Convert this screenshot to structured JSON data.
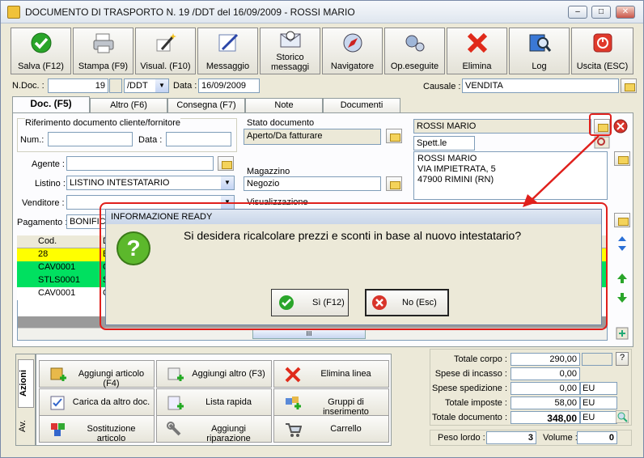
{
  "window": {
    "title": "DOCUMENTO DI TRASPORTO N. 19 /DDT del 16/09/2009 - ROSSI MARIO",
    "min": "–",
    "max": "□",
    "close": "✕"
  },
  "toolbar": [
    {
      "label": "Salva (F12)",
      "icon": "check-icon"
    },
    {
      "label": "Stampa (F9)",
      "icon": "printer-icon"
    },
    {
      "label": "Visual. (F10)",
      "icon": "magic-wand-icon"
    },
    {
      "label": "Messaggio",
      "icon": "message-icon"
    },
    {
      "label": "Storico messaggi",
      "icon": "message-history-icon"
    },
    {
      "label": "Navigatore",
      "icon": "compass-icon"
    },
    {
      "label": "Op.eseguite",
      "icon": "gears-icon"
    },
    {
      "label": "Elimina",
      "icon": "delete-icon"
    },
    {
      "label": "Log",
      "icon": "log-icon"
    },
    {
      "label": "Uscita (ESC)",
      "icon": "exit-icon"
    }
  ],
  "header": {
    "ndoc_label": "N.Doc. :",
    "ndoc_value": "19",
    "series": "/DDT",
    "date_label": "Data :",
    "date_value": "16/09/2009",
    "causale_label": "Causale :",
    "causale_value": "VENDITA"
  },
  "tabs": [
    "Doc. (F5)",
    "Altro (F6)",
    "Consegna (F7)",
    "Note",
    "Documenti"
  ],
  "doc": {
    "riferimento_label": "Riferimento documento cliente/fornitore",
    "num_label": "Num.:",
    "num_value": "",
    "data_label": "Data :",
    "data_value": "",
    "agente_label": "Agente :",
    "agente_value": "",
    "listino_label": "Listino :",
    "listino_value": "LISTINO INTESTATARIO",
    "venditore_label": "Venditore :",
    "venditore_value": "",
    "pagamento_label": "Pagamento :",
    "pagamento_value": "BONIFICO",
    "stato_label": "Stato documento",
    "stato_value": "Aperto/Da fatturare",
    "magazzino_label": "Magazzino",
    "magazzino_value": "Negozio",
    "visualizzazione_label": "Visualizzazione"
  },
  "customer": {
    "name": "ROSSI MARIO",
    "title": "Spett.le",
    "address": [
      "ROSSI MARIO",
      "VIA IMPIETRATA, 5",
      "47900 RIMINI (RN)"
    ]
  },
  "grid": {
    "headers": [
      "Cod.",
      "D"
    ],
    "rows": [
      {
        "code": "28",
        "desc": "B",
        "color": "#ffff00"
      },
      {
        "code": "CAV0001",
        "desc": "C",
        "color": "#00e060"
      },
      {
        "code": "STLS0001",
        "desc": "S",
        "color": "#00e060"
      },
      {
        "code": "CAV0001",
        "desc": "C",
        "color": "#ffffff"
      }
    ],
    "scroll_glyph": "III"
  },
  "actions": {
    "side_tabs": [
      "Azioni",
      "Av."
    ],
    "buttons": [
      {
        "label": "Aggiungi articolo (F4)",
        "icon": "add-article-icon"
      },
      {
        "label": "Aggiungi altro (F3)",
        "icon": "add-other-icon"
      },
      {
        "label": "Elimina linea",
        "icon": "delete-line-icon"
      },
      {
        "label": "Carica da altro doc.",
        "icon": "load-document-icon"
      },
      {
        "label": "Lista rapida",
        "icon": "quick-list-icon"
      },
      {
        "label": "Gruppi di inserimento",
        "icon": "insert-groups-icon"
      },
      {
        "label": "Sostituzione articolo",
        "icon": "replace-article-icon"
      },
      {
        "label": "Aggiungi riparazione",
        "icon": "wrench-icon"
      },
      {
        "label": "Carrello",
        "icon": "cart-icon"
      }
    ]
  },
  "totals": {
    "corpo_label": "Totale corpo :",
    "corpo": "290,00",
    "incasso_label": "Spese di incasso :",
    "incasso": "0,00",
    "spedizione_label": "Spese spedizione :",
    "spedizione": "0,00",
    "imposte_label": "Totale imposte :",
    "imposte": "58,00",
    "documento_label": "Totale documento :",
    "documento": "348,00",
    "currency": "EU",
    "help": "?",
    "peso_label": "Peso lordo :",
    "peso": "3",
    "volume_label": "Volume :",
    "volume": "0"
  },
  "dialog": {
    "title": "INFORMAZIONE READY",
    "question": "Si desidera ricalcolare prezzi e sconti in base al nuovo intestatario?",
    "yes_label": "Sì (F12)",
    "no_label": "No (Esc)"
  },
  "colors": {
    "highlight": "#e0201c"
  }
}
